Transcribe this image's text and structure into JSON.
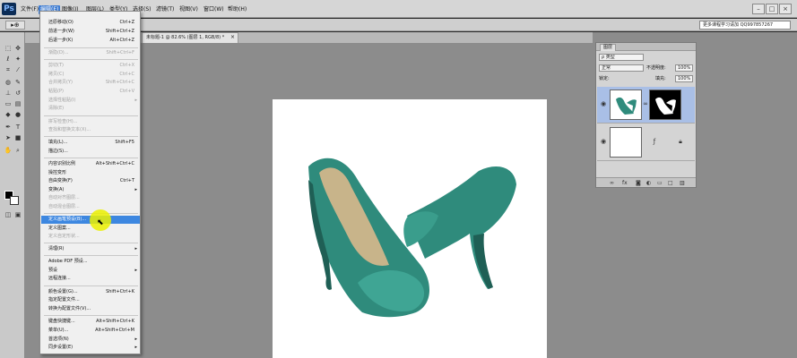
{
  "app": {
    "logo": "Ps"
  },
  "menubar": {
    "items": [
      {
        "label": "文件(F)"
      },
      {
        "label": "编辑(E)"
      },
      {
        "label": "图像(I)"
      },
      {
        "label": "图层(L)"
      },
      {
        "label": "类型(Y)"
      },
      {
        "label": "选择(S)"
      },
      {
        "label": "滤镜(T)"
      },
      {
        "label": "视图(V)"
      },
      {
        "label": "窗口(W)"
      },
      {
        "label": "帮助(H)"
      }
    ],
    "active_index": 1,
    "minimize": "–",
    "maximize": "□",
    "close": "×"
  },
  "options": {
    "tool": "▸⊕",
    "workspace": "更多课程学习请加 QQ997857267"
  },
  "document": {
    "tab_title": "未标题-1 @ 82.6% (图层 1, RGB/8) *",
    "close": "×"
  },
  "edit_menu": {
    "items": [
      {
        "label": "还原移动(O)",
        "shortcut": "Ctrl+Z"
      },
      {
        "label": "前进一步(W)",
        "shortcut": "Shift+Ctrl+Z"
      },
      {
        "label": "后退一步(K)",
        "shortcut": "Alt+Ctrl+Z"
      },
      {
        "label": "渐隐(D)...",
        "shortcut": "Shift+Ctrl+F"
      },
      {
        "label": "剪切(T)",
        "shortcut": "Ctrl+X"
      },
      {
        "label": "拷贝(C)",
        "shortcut": "Ctrl+C"
      },
      {
        "label": "合并拷贝(Y)",
        "shortcut": "Shift+Ctrl+C"
      },
      {
        "label": "粘贴(P)",
        "shortcut": "Ctrl+V"
      },
      {
        "label": "选择性粘贴(I)",
        "shortcut": ""
      },
      {
        "label": "清除(E)",
        "shortcut": ""
      },
      {
        "label": "拼写检查(H)...",
        "shortcut": ""
      },
      {
        "label": "查找和替换文本(X)...",
        "shortcut": ""
      },
      {
        "label": "填充(L)...",
        "shortcut": "Shift+F5"
      },
      {
        "label": "描边(S)...",
        "shortcut": ""
      },
      {
        "label": "内容识别比例",
        "shortcut": "Alt+Shift+Ctrl+C"
      },
      {
        "label": "操控变形",
        "shortcut": ""
      },
      {
        "label": "自由变换(F)",
        "shortcut": "Ctrl+T"
      },
      {
        "label": "变换(A)",
        "shortcut": ""
      },
      {
        "label": "自动对齐图层...",
        "shortcut": ""
      },
      {
        "label": "自动混合图层...",
        "shortcut": ""
      },
      {
        "label": "定义画笔预设(B)...",
        "shortcut": ""
      },
      {
        "label": "定义图案...",
        "shortcut": ""
      },
      {
        "label": "定义自定形状...",
        "shortcut": ""
      },
      {
        "label": "清理(R)",
        "shortcut": ""
      },
      {
        "label": "Adobe PDF 预设...",
        "shortcut": ""
      },
      {
        "label": "预设",
        "shortcut": ""
      },
      {
        "label": "远程连接...",
        "shortcut": ""
      },
      {
        "label": "颜色设置(G)...",
        "shortcut": "Shift+Ctrl+K"
      },
      {
        "label": "指定配置文件...",
        "shortcut": ""
      },
      {
        "label": "转换为配置文件(V)...",
        "shortcut": ""
      },
      {
        "label": "键盘快捷键...",
        "shortcut": "Alt+Shift+Ctrl+K"
      },
      {
        "label": "菜单(U)...",
        "shortcut": "Alt+Shift+Ctrl+M"
      },
      {
        "label": "首选项(N)",
        "shortcut": ""
      },
      {
        "label": "同步设置(E)",
        "shortcut": ""
      }
    ],
    "submenu_arrow": "▸",
    "cursor": "⬉"
  },
  "layers_panel": {
    "tab": "图层",
    "filter": "ρ 类型",
    "blend_mode": "正常",
    "opacity_label": "不透明度:",
    "opacity_value": "100%",
    "lock_label": "锁定:",
    "fill_label": "填充:",
    "fill_value": "100%"
  },
  "colors": {
    "menu_highlight": "#3d87e0",
    "canvas_bg": "#8c8c8c",
    "shoe": "#2f8b7c"
  }
}
